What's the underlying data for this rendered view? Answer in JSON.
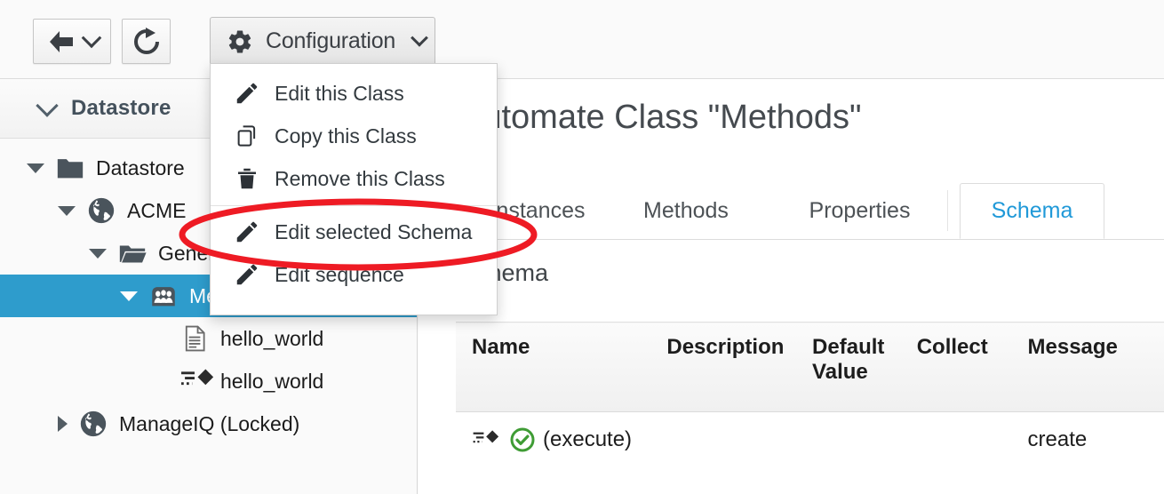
{
  "colors": {
    "accent_blue": "#2099d8",
    "selection_blue": "#2e9ccc",
    "annotation_red": "#ee1b24",
    "status_green": "#3f9c35",
    "icon_dark": "#4a545c",
    "text_dark": "#1d1d1d"
  },
  "toolbar": {
    "back_button": {
      "name": "back-button",
      "icon": "arrow-left-icon",
      "caret": "chevron-down-icon"
    },
    "reload_button": {
      "name": "reload-button",
      "icon": "refresh-icon"
    },
    "configuration_button": {
      "label": "Configuration",
      "icon": "gear-icon",
      "caret": "chevron-down-icon"
    }
  },
  "config_menu": {
    "open": true,
    "items": [
      {
        "label": "Edit this Class",
        "icon": "pencil-icon",
        "separator_after": false
      },
      {
        "label": "Copy this Class",
        "icon": "copy-icon",
        "separator_after": false
      },
      {
        "label": "Remove this Class",
        "icon": "trash-icon",
        "separator_after": true
      },
      {
        "label": "Edit selected Schema",
        "icon": "pencil-icon",
        "separator_after": false,
        "highlighted": true
      },
      {
        "label": "Edit sequence",
        "icon": "pencil-icon",
        "separator_after": false
      }
    ]
  },
  "annotation": {
    "shape": "ellipse",
    "color": "#ee1b24",
    "targets": "Edit selected Schema"
  },
  "sidebar": {
    "accordion": {
      "label": "Datastore",
      "expanded": true,
      "caret": "chevron-down-icon"
    },
    "tree": [
      {
        "label": "Datastore",
        "icon": "folder-closed-icon",
        "depth": 0,
        "state": "expanded",
        "selected": false
      },
      {
        "label": "ACME",
        "icon": "globe-icon",
        "depth": 1,
        "state": "expanded",
        "selected": false
      },
      {
        "label": "General",
        "icon": "folder-open-icon",
        "depth": 2,
        "state": "expanded",
        "selected": false
      },
      {
        "label": "Methods",
        "icon": "class-icon",
        "depth": 3,
        "state": "expanded",
        "selected": true
      },
      {
        "label": "hello_world",
        "icon": "document-icon",
        "depth": 4,
        "state": "leaf",
        "selected": false
      },
      {
        "label": "hello_world",
        "icon": "method-icon",
        "depth": 4,
        "state": "leaf",
        "selected": false
      },
      {
        "label": "ManageIQ (Locked)",
        "icon": "globe-icon",
        "depth": 1,
        "state": "collapsed",
        "selected": false
      }
    ]
  },
  "main": {
    "page_title": "Automate Class \"Methods\"",
    "tabs": [
      {
        "label": "Instances",
        "active": false
      },
      {
        "label": "Methods",
        "active": false
      },
      {
        "label": "Properties",
        "active": false
      },
      {
        "label": "Schema",
        "active": true
      }
    ],
    "subtitle": "Schema",
    "table": {
      "columns": [
        "Name",
        "Description",
        "Default Value",
        "Collect",
        "Message"
      ],
      "rows": [
        {
          "name": "(execute)",
          "name_icon": "method-icon",
          "status_icon": "check-circle-icon",
          "description": "",
          "default_value": "",
          "collect": "",
          "message": "create"
        }
      ]
    }
  }
}
